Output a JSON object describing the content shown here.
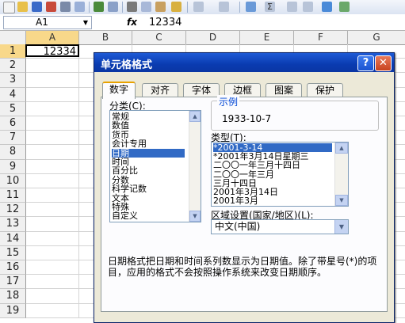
{
  "formula_bar": {
    "cell_ref": "A1",
    "fx": "fx",
    "value": "12334"
  },
  "grid": {
    "columns": [
      "A",
      "B",
      "C",
      "D",
      "E",
      "F",
      "G"
    ],
    "rows": [
      "1",
      "2",
      "3",
      "4",
      "5",
      "6",
      "7",
      "8",
      "9",
      "10",
      "11",
      "12",
      "13",
      "14",
      "15",
      "16",
      "17",
      "18",
      "19"
    ],
    "cell_A1": "12334"
  },
  "dialog": {
    "title": "单元格格式",
    "help": "?",
    "close": "✕",
    "tabs": [
      "数字",
      "对齐",
      "字体",
      "边框",
      "图案",
      "保护"
    ],
    "active_tab": "数字",
    "category_label": "分类(C):",
    "categories": [
      "常规",
      "数值",
      "货币",
      "会计专用",
      "日期",
      "时间",
      "百分比",
      "分数",
      "科学记数",
      "文本",
      "特殊",
      "自定义"
    ],
    "selected_category": "日期",
    "sample_label": "示例",
    "sample_value": "1933-10-7",
    "type_label": "类型(T):",
    "types": [
      "*2001-3-14",
      "*2001年3月14日星期三",
      "二〇〇一年三月十四日",
      "二〇〇一年三月",
      "三月十四日",
      "2001年3月14日",
      "2001年3月"
    ],
    "selected_type": "*2001-3-14",
    "locale_label": "区域设置(国家/地区)(L):",
    "locale_value": "中文(中国)",
    "description": "日期格式把日期和时间系列数显示为日期值。除了带星号(*)的项目，应用的格式不会按照操作系统来改变日期顺序。"
  },
  "colors": {
    "title_bar": "#0a3bb0",
    "selection": "#316ac5",
    "dialog_bg": "#ece9d8"
  }
}
